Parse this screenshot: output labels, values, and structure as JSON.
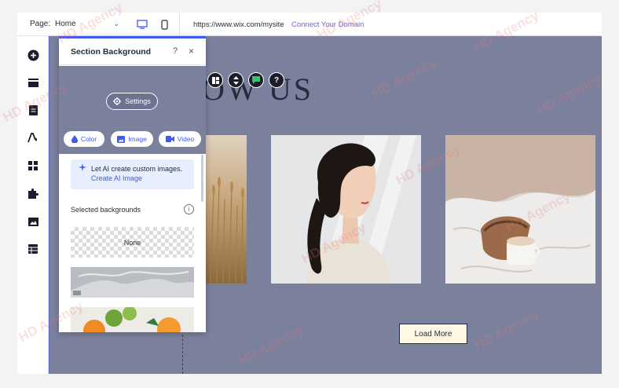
{
  "topbar": {
    "page_label": "Page:",
    "page_value": "Home",
    "url": "https://www.wix.com/mysite",
    "connect_domain": "Connect Your Domain"
  },
  "left_toolbar": {
    "icons": [
      "add-icon",
      "sections-icon",
      "pages-icon",
      "theme-icon",
      "apps-icon",
      "puzzle-icon",
      "media-icon",
      "table-icon"
    ]
  },
  "canvas": {
    "heading": "OW US",
    "load_more": "Load More",
    "background_color": "#7b819d"
  },
  "panel": {
    "title": "Section Background",
    "help": "?",
    "close": "×",
    "settings": "Settings",
    "tabs": {
      "color": "Color",
      "image": "Image",
      "video": "Video"
    },
    "ai_text": "Let AI create custom images.",
    "ai_link": "Create AI Image",
    "selected_label": "Selected backgrounds",
    "info": "i",
    "none_label": "None"
  },
  "watermark": "HD Agency",
  "colors": {
    "accent": "#3e5af2",
    "connect": "#7a5cd6",
    "canvas": "#7b819d",
    "button_bg": "#fdf7e4"
  }
}
